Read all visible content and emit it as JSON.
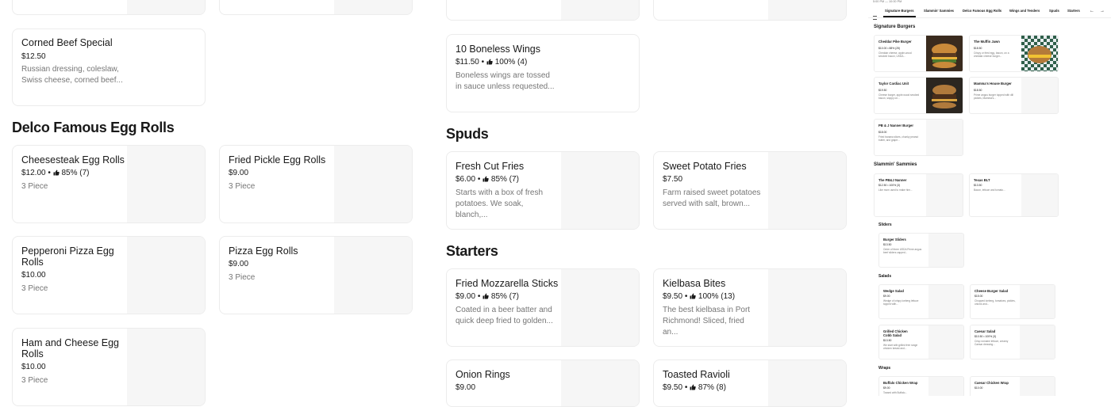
{
  "main": {
    "cards": [
      {
        "key": "corned",
        "name": "Corned Beef Special",
        "price": "$12.50",
        "desc1": "Russian dressing, coleslaw,",
        "desc2": "Swiss cheese, corned beef..."
      },
      {
        "key": "cheesesteak",
        "name": "Cheesesteak Egg Rolls",
        "price": "$12.00",
        "rating": "85% (7)",
        "desc1": "3 Piece"
      },
      {
        "key": "pickle",
        "name": "Fried Pickle Egg Rolls",
        "price": "$9.00",
        "desc1": "3 Piece"
      },
      {
        "key": "pepperoni",
        "name1": "Pepperoni Pizza Egg",
        "name2": "Rolls",
        "price": "$10.00",
        "desc1": "3 Piece"
      },
      {
        "key": "pizza",
        "name": "Pizza Egg Rolls",
        "price": "$9.00",
        "desc1": "3 Piece"
      },
      {
        "key": "ham",
        "name1": "Ham and Cheese Egg",
        "name2": "Rolls",
        "price": "$10.00",
        "desc1": "3 Piece"
      },
      {
        "key": "wings",
        "name": "10 Boneless Wings",
        "price": "$11.50",
        "rating": "100% (4)",
        "desc1": "Boneless wings are tossed",
        "desc2": "in sauce unless requested..."
      },
      {
        "key": "fresh",
        "name": "Fresh Cut Fries",
        "price": "$6.00",
        "rating": "85% (7)",
        "desc1": "Starts with a box of fresh",
        "desc2": "potatoes. We soak, blanch,..."
      },
      {
        "key": "sweet",
        "name": "Sweet Potato Fries",
        "price": "$7.50",
        "desc1": "Farm raised sweet potatoes",
        "desc2": "served with salt, brown..."
      },
      {
        "key": "mozz",
        "name": "Fried Mozzarella Sticks",
        "price": "$9.00",
        "rating": "85% (7)",
        "desc1": "Coated in a beer batter and",
        "desc2": "quick deep fried to golden..."
      },
      {
        "key": "kielbasa",
        "name": "Kielbasa Bites",
        "price": "$9.50",
        "rating": "100% (13)",
        "desc1": "The best kielbasa in Port",
        "desc2": "Richmond! Sliced, fried an..."
      },
      {
        "key": "onion",
        "name": "Onion Rings",
        "price": "$9.00"
      },
      {
        "key": "ravioli",
        "name": "Toasted Ravioli",
        "price": "$9.50",
        "rating": "87% (8)"
      }
    ],
    "sections": {
      "egg_rolls": "Delco Famous Egg Rolls",
      "spuds": "Spuds",
      "starters": "Starters"
    },
    "separator": "•"
  },
  "mini": {
    "time": "5:00 PM — 10:00 PM",
    "tabs": [
      "Signature Burgers",
      "Slammin' Sammies",
      "Delco Famous Egg Rolls",
      "Wings and Tenders",
      "Spuds",
      "Starters"
    ],
    "sections": {
      "burgers": "Signature Burgers",
      "sammies": "Slammin' Sammies",
      "sliders": "Sliders",
      "salads": "Salads",
      "wraps": "Wraps"
    },
    "cards": [
      {
        "name": "Cheddar Pike Burger",
        "price": "$10.00 • 88% (25)",
        "desc": "Cheddar cheese, apple-wood smoked bacon, USDA..."
      },
      {
        "name": "The Muffin Jawn",
        "price": "$18.50",
        "desc": "Crispy or fried egg, bacon, on a cheddar cheese burger..."
      },
      {
        "name": "Taylor Cardiac Unit",
        "price": "$19.50",
        "desc": "Cheese burger, apple-wood smoked bacon, sloppy on..."
      },
      {
        "name": "Mamma's House Burger",
        "price": "$18.50",
        "desc": "Prime angus burger topped with dill pickles, Mamma's..."
      },
      {
        "name": "PB & J Nanner Burger",
        "price": "$18.00",
        "desc": "Fried banana slices, chunky peanut butter, and grape..."
      },
      {
        "name": "The PB&J Nanner",
        "price": "$12.50 • 100% (3)",
        "desc": "Like mom used to make him..."
      },
      {
        "name": "Texas BLT",
        "price": "$13.50",
        "desc": "Bacon, lettuce and tomato..."
      },
      {
        "name": "Burger Sliders",
        "price": "$13.50",
        "desc": "Order of three USDA Prime angus beef sliders capped..."
      },
      {
        "name": "Wedge Salad",
        "price": "$9.00",
        "desc": "Wedge of crispy iceberg lettuce topped with..."
      },
      {
        "name": "Cheese Burger Salad",
        "price": "$15.00",
        "desc": "Chopped iceberg, tomatoes, pickles, onions and..."
      },
      {
        "name": "Grilled Chicken Cobb Salad",
        "price": "$13.50",
        "desc": "We start with grilled free range chicken breast and..."
      },
      {
        "name": "Caesar Salad",
        "price": "$10.50 • 100% (3)",
        "desc": "Crisp romaine lettuce, creamy Caesar dressing..."
      },
      {
        "name": "Buffalo Chicken Wrap",
        "price": "$9.00",
        "desc": "Tossed with Buffalo..."
      },
      {
        "name": "Caesar Chicken Wrap",
        "price": "$10.00",
        "desc": ""
      }
    ]
  }
}
